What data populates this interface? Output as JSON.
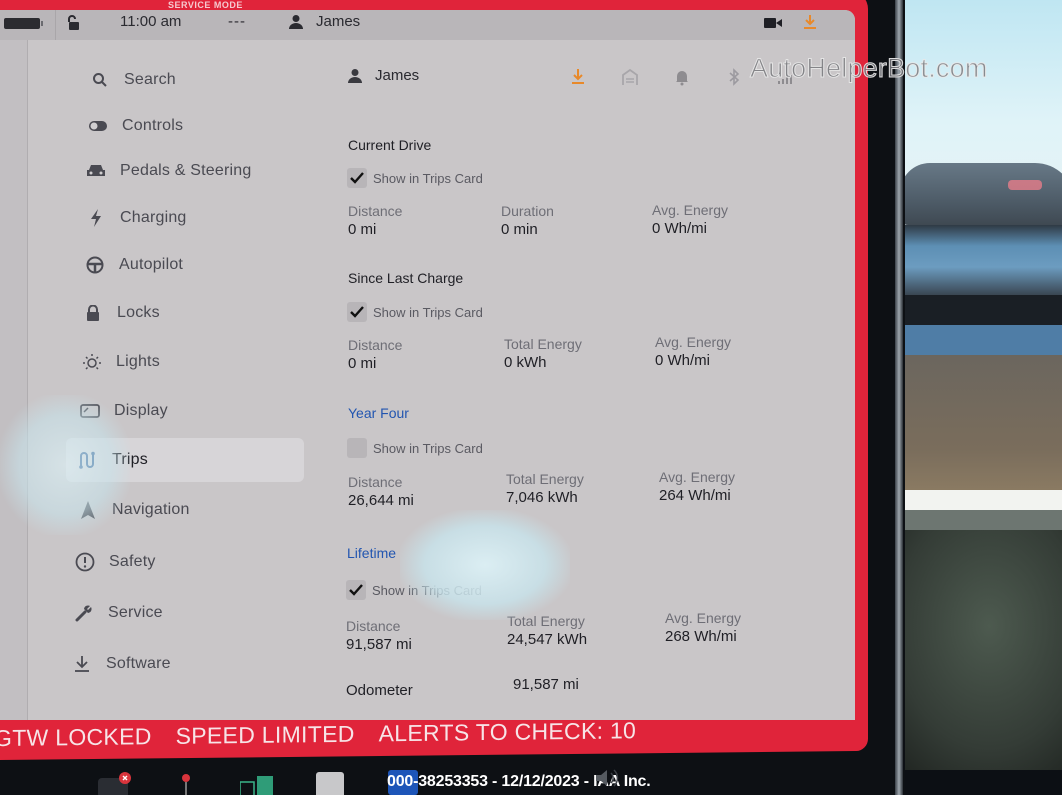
{
  "banner": {
    "service_mode": "SERVICE MODE"
  },
  "status_bar": {
    "time": "11:00 am",
    "temperature": "---",
    "user": "James"
  },
  "sidebar": {
    "items": [
      {
        "label": "Search",
        "icon": "search-icon"
      },
      {
        "label": "Controls",
        "icon": "toggle-icon"
      },
      {
        "label": "Pedals & Steering",
        "icon": "car-icon"
      },
      {
        "label": "Charging",
        "icon": "lightning-icon"
      },
      {
        "label": "Autopilot",
        "icon": "steering-wheel-icon"
      },
      {
        "label": "Locks",
        "icon": "lock-icon"
      },
      {
        "label": "Lights",
        "icon": "sun-icon"
      },
      {
        "label": "Display",
        "icon": "display-icon"
      },
      {
        "label": "Trips",
        "icon": "trips-route-icon",
        "active": true
      },
      {
        "label": "Navigation",
        "icon": "navigation-arrow-icon"
      },
      {
        "label": "Safety",
        "icon": "alert-circle-icon"
      },
      {
        "label": "Service",
        "icon": "wrench-icon"
      },
      {
        "label": "Software",
        "icon": "download-icon"
      }
    ]
  },
  "content": {
    "header": {
      "user": "James",
      "icons": [
        "download-icon",
        "garage-icon",
        "bell-icon",
        "bluetooth-icon",
        "signal-icon"
      ],
      "accent_color": "#e8892a"
    },
    "checkbox_label": "Show in Trips Card",
    "sections": [
      {
        "title": "Current Drive",
        "checked": true,
        "stats": [
          {
            "label": "Distance",
            "value": "0 mi"
          },
          {
            "label": "Duration",
            "value": "0 min"
          },
          {
            "label": "Avg. Energy",
            "value": "0 Wh/mi"
          }
        ]
      },
      {
        "title": "Since Last Charge",
        "checked": true,
        "stats": [
          {
            "label": "Distance",
            "value": "0 mi"
          },
          {
            "label": "Total Energy",
            "value": "0 kWh"
          },
          {
            "label": "Avg. Energy",
            "value": "0 Wh/mi"
          }
        ]
      },
      {
        "title": "Year Four",
        "checked": false,
        "stats": [
          {
            "label": "Distance",
            "value": "26,644 mi"
          },
          {
            "label": "Total Energy",
            "value": "7,046 kWh"
          },
          {
            "label": "Avg. Energy",
            "value": "264 Wh/mi"
          }
        ]
      },
      {
        "title": "Lifetime",
        "checked": true,
        "stats": [
          {
            "label": "Distance",
            "value": "91,587 mi"
          },
          {
            "label": "Total Energy",
            "value": "24,547 kWh"
          },
          {
            "label": "Avg. Energy",
            "value": "268 Wh/mi"
          }
        ]
      }
    ],
    "odometer": {
      "label": "Odometer",
      "value": "91,587 mi"
    }
  },
  "alerts": [
    "GTW LOCKED",
    "SPEED LIMITED",
    "ALERTS TO CHECK: 10"
  ],
  "caption": "000-38253353 - 12/12/2023 - IAA Inc.",
  "watermark": "AutoHelperBot.com",
  "colors": {
    "service_red": "#e0243a",
    "link_blue": "#2255b0",
    "trips_icon_blue": "#1d4f8a"
  }
}
